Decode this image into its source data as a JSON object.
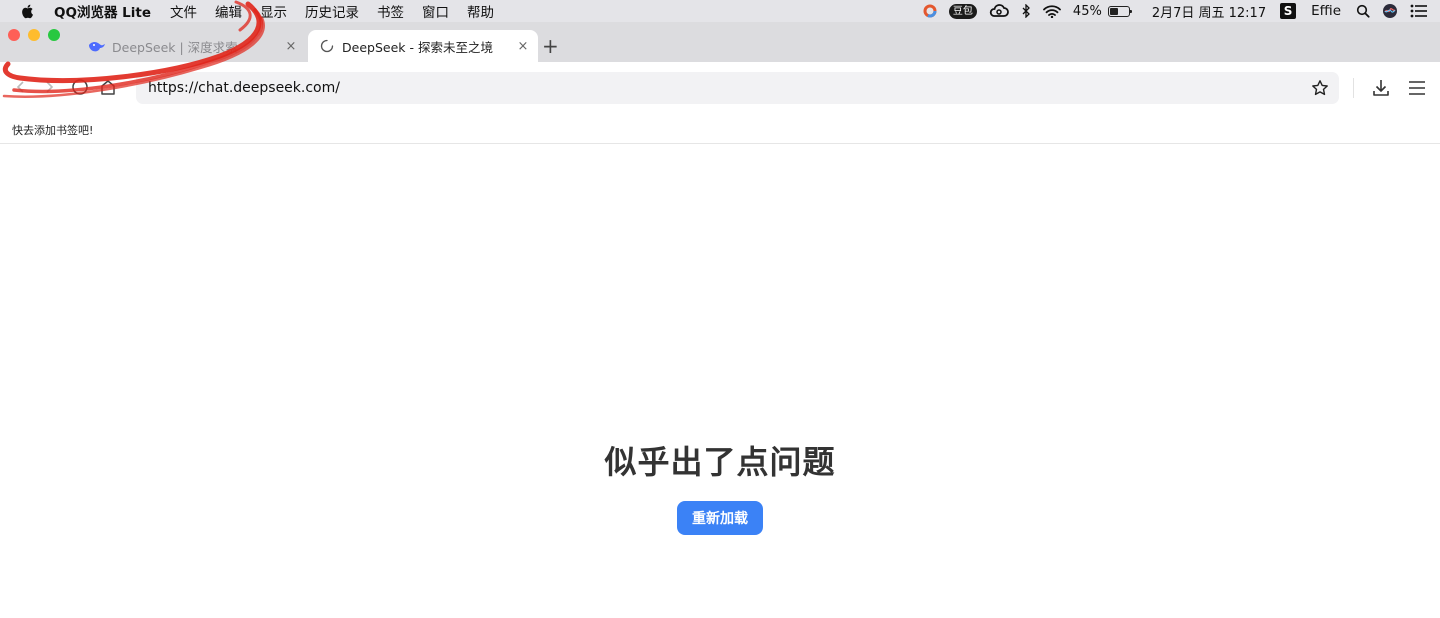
{
  "menubar": {
    "apple_icon": "apple-icon",
    "items": [
      "QQ浏览器 Lite",
      "文件",
      "编辑",
      "显示",
      "历史记录",
      "书签",
      "窗口",
      "帮助"
    ],
    "status": {
      "doubao_label": "豆包",
      "battery_percent": "45%",
      "battery_level": 0.45,
      "datetime": "2月7日 周五 12:17",
      "s_badge": "S",
      "user": "Effie"
    }
  },
  "tabs": [
    {
      "title": "DeepSeek | 深度求索",
      "close": "×",
      "active": false,
      "favicon": "deepseek-whale-icon"
    },
    {
      "title": "DeepSeek - 探索未至之境",
      "close": "×",
      "active": true,
      "favicon": "loading-spinner-icon"
    }
  ],
  "new_tab_label": "+",
  "address_bar": {
    "url": "https://chat.deepseek.com/"
  },
  "bookmarks_bar": {
    "hint": "快去添加书签吧!"
  },
  "page": {
    "error_title": "似乎出了点问题",
    "reload_button": "重新加载"
  },
  "colors": {
    "accent": "#3b82f6",
    "annotation_red": "#e0261b",
    "traffic_red": "#fe5f57",
    "traffic_yellow": "#febc2e",
    "traffic_green": "#28c840"
  }
}
